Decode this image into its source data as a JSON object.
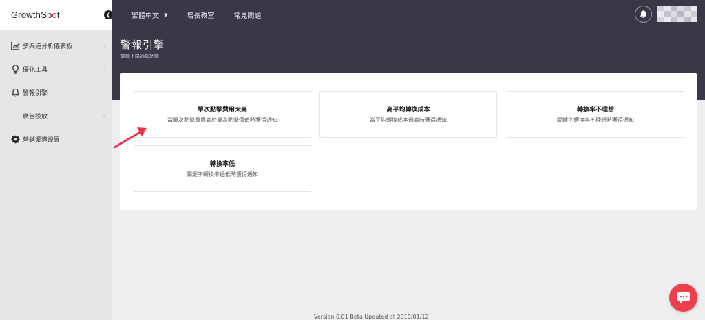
{
  "brand": {
    "logo_prefix": "GrowthSp",
    "logo_dot": "o",
    "logo_suffix": "t"
  },
  "sidebar": {
    "collapse_icon": "chevron-left-icon",
    "items": [
      {
        "label": "多渠道分析儀表板",
        "icon": "chart-icon",
        "has_arrow": true
      },
      {
        "label": "優化工具",
        "icon": "lightbulb-icon",
        "has_arrow": true
      },
      {
        "label": "警報引擎",
        "icon": "bell-icon",
        "has_arrow": false
      },
      {
        "label": "廣告投放",
        "icon": "",
        "has_arrow": true
      },
      {
        "label": "營銷渠道設置",
        "icon": "gear-icon",
        "has_arrow": false
      }
    ],
    "arrow_glyph": "›"
  },
  "topbar": {
    "links": [
      {
        "label": "繁體中文",
        "has_caret": true
      },
      {
        "label": "增長教室",
        "has_caret": false
      },
      {
        "label": "常見問題",
        "has_caret": false
      }
    ],
    "caret_glyph": "▼"
  },
  "header": {
    "title": "警報引擎",
    "subtitle": "效能下降通知功能"
  },
  "alerts": [
    {
      "title": "單次點擊費用太高",
      "desc": "當單次點擊費用高於單次點擊價值時獲得通知"
    },
    {
      "title": "高平均轉換成本",
      "desc": "當平均轉換成本過高時獲得通知"
    },
    {
      "title": "轉換率不理想",
      "desc": "關鍵字轉換率不理想時獲得通知"
    },
    {
      "title": "轉換率低",
      "desc": "關鍵字轉換率過低時獲得通知"
    }
  ],
  "footer": {
    "version": "Version 0.01 Beta Updated at 2019/01/12"
  },
  "colors": {
    "topbar_bg": "#393846",
    "sidebar_bg": "#e6e6e9",
    "accent_red": "#e0293b",
    "chat_red": "#ef3f4c",
    "annotation_arrow": "#e8344a"
  }
}
